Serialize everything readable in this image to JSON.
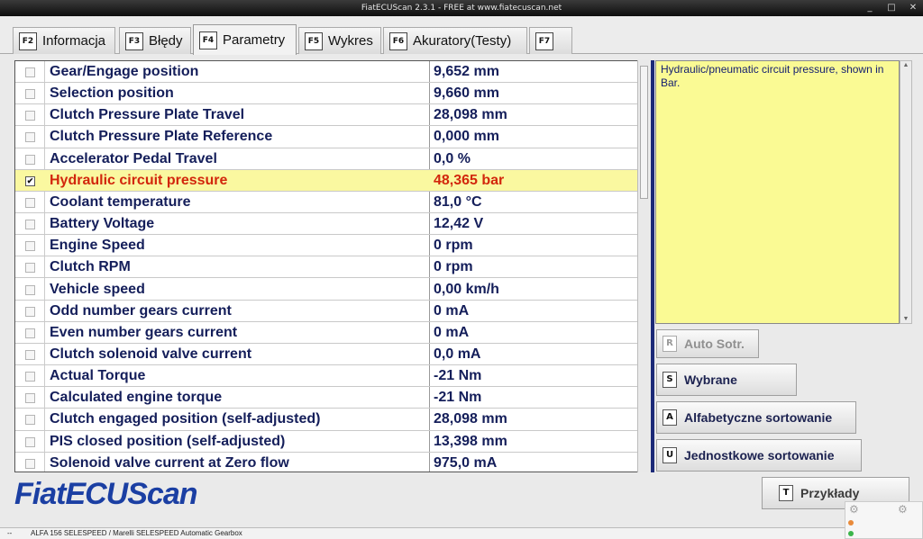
{
  "window": {
    "title": "FiatECUScan 2.3.1 - FREE at www.fiatecuscan.net",
    "buttons": {
      "minimize": "_",
      "maximize": "□",
      "close": "✕"
    }
  },
  "tabs": [
    {
      "key": "F2",
      "label": "Informacja"
    },
    {
      "key": "F3",
      "label": "Błędy"
    },
    {
      "key": "F4",
      "label": "Parametry"
    },
    {
      "key": "F5",
      "label": "Wykres"
    },
    {
      "key": "F6",
      "label": "Akuratory(Testy)"
    },
    {
      "key": "F7",
      "label": ""
    }
  ],
  "parameters": [
    {
      "name": "Gear/Engage position",
      "value": "9,652 mm",
      "checked": false
    },
    {
      "name": "Selection position",
      "value": "9,660 mm",
      "checked": false
    },
    {
      "name": "Clutch Pressure Plate Travel",
      "value": "28,098 mm",
      "checked": false
    },
    {
      "name": "Clutch Pressure Plate Reference",
      "value": "0,000 mm",
      "checked": false
    },
    {
      "name": "Accelerator Pedal Travel",
      "value": "0,0 %",
      "checked": false
    },
    {
      "name": "Hydraulic circuit pressure",
      "value": "48,365 bar",
      "checked": true
    },
    {
      "name": "Coolant temperature",
      "value": "81,0 °C",
      "checked": false
    },
    {
      "name": "Battery Voltage",
      "value": "12,42 V",
      "checked": false
    },
    {
      "name": "Engine Speed",
      "value": "0 rpm",
      "checked": false
    },
    {
      "name": "Clutch RPM",
      "value": "0 rpm",
      "checked": false
    },
    {
      "name": "Vehicle speed",
      "value": "0,00 km/h",
      "checked": false
    },
    {
      "name": "Odd number gears current",
      "value": "0 mA",
      "checked": false
    },
    {
      "name": "Even number gears current",
      "value": "0 mA",
      "checked": false
    },
    {
      "name": "Clutch solenoid valve current",
      "value": "0,0 mA",
      "checked": false
    },
    {
      "name": "Actual Torque",
      "value": "-21 Nm",
      "checked": false
    },
    {
      "name": "Calculated engine torque",
      "value": "-21 Nm",
      "checked": false
    },
    {
      "name": "Clutch engaged position (self-adjusted)",
      "value": "28,098 mm",
      "checked": false
    },
    {
      "name": "PIS closed position (self-adjusted)",
      "value": "13,398 mm",
      "checked": false
    },
    {
      "name": "Solenoid valve current at Zero flow",
      "value": "975,0 mA",
      "checked": false
    }
  ],
  "description": "Hydraulic/pneumatic circuit pressure, shown in Bar.",
  "sort_buttons": {
    "auto": {
      "key": "R",
      "label": "Auto Sotr."
    },
    "selected": {
      "key": "S",
      "label": "Wybrane"
    },
    "alpha": {
      "key": "A",
      "label": "Alfabetyczne sortowanie"
    },
    "unit": {
      "key": "U",
      "label": "Jednostkowe sortowanie"
    }
  },
  "examples_button": {
    "key": "T",
    "label": "Przykłady"
  },
  "logo": "FiatECUScan",
  "status": {
    "left": "--",
    "vehicle": "ALFA 156 SELESPEED / Marelli SELESPEED Automatic Gearbox"
  },
  "colors": {
    "label": "#141e5a",
    "selected_text": "#d2260c",
    "selected_bg": "#faf8a0",
    "panel": "#fafa94",
    "logo": "#1b3fa3"
  }
}
